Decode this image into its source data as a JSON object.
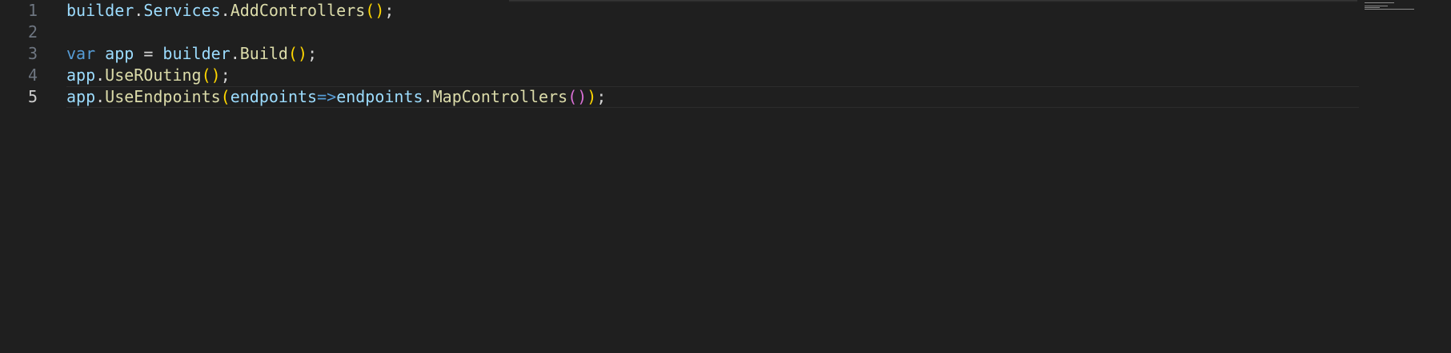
{
  "editor": {
    "line_numbers": [
      "1",
      "2",
      "3",
      "4",
      "5"
    ],
    "active_line": "5",
    "lines": [
      {
        "number": "1",
        "tokens": [
          {
            "text": "builder",
            "kind": "var"
          },
          {
            "text": ".",
            "kind": "op"
          },
          {
            "text": "Services",
            "kind": "var"
          },
          {
            "text": ".",
            "kind": "op"
          },
          {
            "text": "AddControllers",
            "kind": "fn"
          },
          {
            "text": "()",
            "kind": "p1"
          },
          {
            "text": ";",
            "kind": "op"
          }
        ]
      },
      {
        "number": "2",
        "tokens": []
      },
      {
        "number": "3",
        "tokens": [
          {
            "text": "var",
            "kind": "kw"
          },
          {
            "text": " ",
            "kind": "op"
          },
          {
            "text": "app",
            "kind": "var"
          },
          {
            "text": " = ",
            "kind": "op"
          },
          {
            "text": "builder",
            "kind": "var"
          },
          {
            "text": ".",
            "kind": "op"
          },
          {
            "text": "Build",
            "kind": "fn"
          },
          {
            "text": "()",
            "kind": "p1"
          },
          {
            "text": ";",
            "kind": "op"
          }
        ]
      },
      {
        "number": "4",
        "tokens": [
          {
            "text": "app",
            "kind": "var"
          },
          {
            "text": ".",
            "kind": "op"
          },
          {
            "text": "UseROuting",
            "kind": "fn"
          },
          {
            "text": "()",
            "kind": "p1"
          },
          {
            "text": ";",
            "kind": "op"
          }
        ]
      },
      {
        "number": "5",
        "tokens": [
          {
            "text": "app",
            "kind": "var"
          },
          {
            "text": ".",
            "kind": "op"
          },
          {
            "text": "UseEndpoints",
            "kind": "fn"
          },
          {
            "text": "(",
            "kind": "p1"
          },
          {
            "text": "endpoints",
            "kind": "var"
          },
          {
            "text": "=>",
            "kind": "arrow"
          },
          {
            "text": "endpoints",
            "kind": "var"
          },
          {
            "text": ".",
            "kind": "op"
          },
          {
            "text": "MapControllers",
            "kind": "fn"
          },
          {
            "text": "()",
            "kind": "p2"
          },
          {
            "text": ")",
            "kind": "p1"
          },
          {
            "text": ";",
            "kind": "op"
          }
        ]
      }
    ]
  },
  "theme": {
    "background": "#1f1f1f",
    "line_number": "#6e7681",
    "line_number_active": "#cccccc",
    "variable": "#9cdcfe",
    "function": "#dcdcaa",
    "keyword": "#569cd6",
    "bracket_level1": "#ffd700",
    "bracket_level2": "#da70d6"
  }
}
